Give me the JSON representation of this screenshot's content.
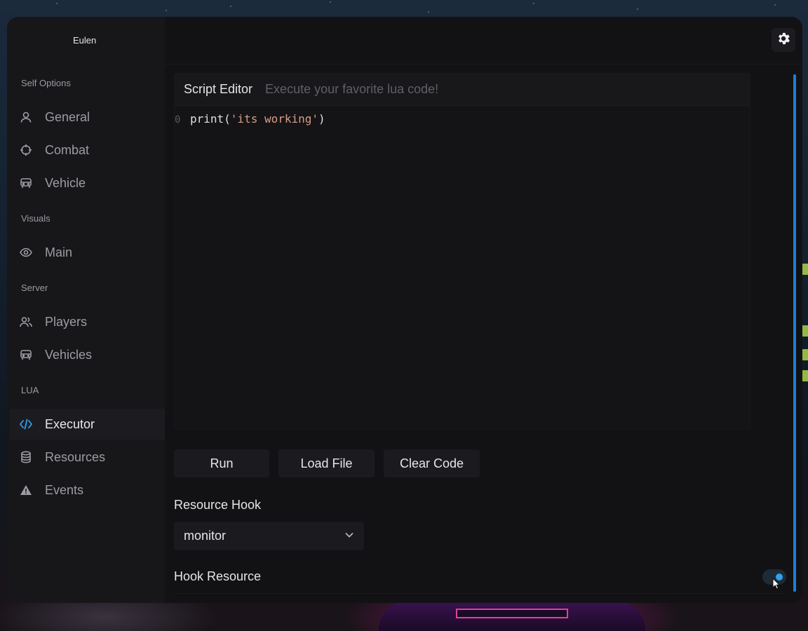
{
  "app": {
    "brand": "Eulen",
    "accent": "#2fa0ec"
  },
  "sidebar": {
    "sections": [
      {
        "title": "Self Options",
        "items": [
          {
            "label": "General",
            "icon": "user-icon"
          },
          {
            "label": "Combat",
            "icon": "crosshair-icon"
          },
          {
            "label": "Vehicle",
            "icon": "car-icon"
          }
        ]
      },
      {
        "title": "Visuals",
        "items": [
          {
            "label": "Main",
            "icon": "eye-icon"
          }
        ]
      },
      {
        "title": "Server",
        "items": [
          {
            "label": "Players",
            "icon": "users-icon"
          },
          {
            "label": "Vehicles",
            "icon": "car-icon"
          }
        ]
      },
      {
        "title": "LUA",
        "items": [
          {
            "label": "Executor",
            "icon": "code-icon",
            "active": true
          },
          {
            "label": "Resources",
            "icon": "database-icon"
          },
          {
            "label": "Events",
            "icon": "warning-icon"
          }
        ]
      }
    ]
  },
  "topbar": {
    "settings_icon": "gear-icon"
  },
  "editor": {
    "title": "Script Editor",
    "subtitle": "Execute your favorite lua code!",
    "line_number": "0",
    "code_fn": "print(",
    "code_str": "'its working'",
    "code_end": ")"
  },
  "actions": {
    "run": "Run",
    "load_file": "Load File",
    "clear_code": "Clear Code"
  },
  "resource_hook": {
    "label": "Resource Hook",
    "selected": "monitor"
  },
  "hook_resource": {
    "label": "Hook Resource",
    "enabled": true
  }
}
